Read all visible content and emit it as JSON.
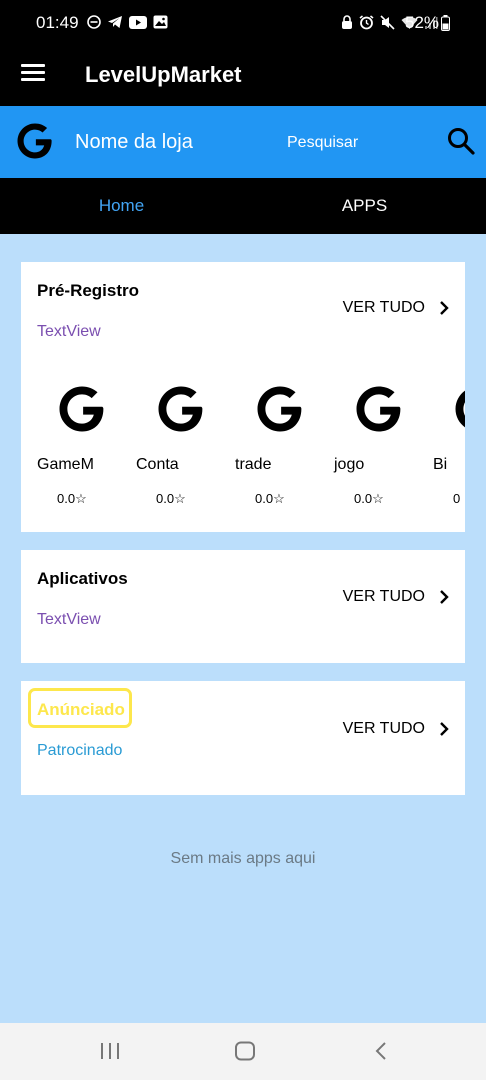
{
  "status_bar": {
    "time": "01:49",
    "left_icons": [
      "minus-circle-icon",
      "telegram-icon",
      "youtube-icon",
      "image-icon"
    ],
    "right_icons": [
      "lock-icon",
      "alarm-icon",
      "mute-icon",
      "wifi-icon",
      "signal-icon"
    ],
    "battery": "52%"
  },
  "app_bar": {
    "title": "LevelUpMarket",
    "menu_icon": "hamburger-menu-icon"
  },
  "store_bar": {
    "logo_icon": "g-logo-icon",
    "store_name": "Nome da loja",
    "search_label": "Pesquisar",
    "search_icon": "search-icon"
  },
  "tabs": [
    {
      "label": "Home",
      "active": true
    },
    {
      "label": "APPS",
      "active": false
    }
  ],
  "sections": {
    "pre_registro": {
      "title": "Pré-Registro",
      "subtitle": "TextView",
      "see_all": "VER TUDO",
      "apps": [
        {
          "name": "GameM",
          "rating": "0.0☆"
        },
        {
          "name": "Conta",
          "rating": "0.0☆"
        },
        {
          "name": "trade",
          "rating": "0.0☆"
        },
        {
          "name": "jogo",
          "rating": "0.0☆"
        },
        {
          "name": "Bi",
          "rating": "0"
        }
      ]
    },
    "aplicativos": {
      "title": "Aplicativos",
      "subtitle": "TextView",
      "see_all": "VER TUDO"
    },
    "anunciado": {
      "title": "Anúnciado",
      "subtitle": "Patrocinado",
      "see_all": "VER TUDO"
    }
  },
  "footer_message": "Sem mais apps aqui",
  "nav_bar": {
    "buttons": [
      "recent-apps-icon",
      "home-icon",
      "back-icon"
    ]
  },
  "colors": {
    "primary": "#2196f3",
    "background": "#bbdefb",
    "active_tab": "#42a5f5",
    "textview_purple": "#7b4fb0",
    "sponsored_blue": "#2a9bd4",
    "highlight_yellow": "#fde74c"
  }
}
